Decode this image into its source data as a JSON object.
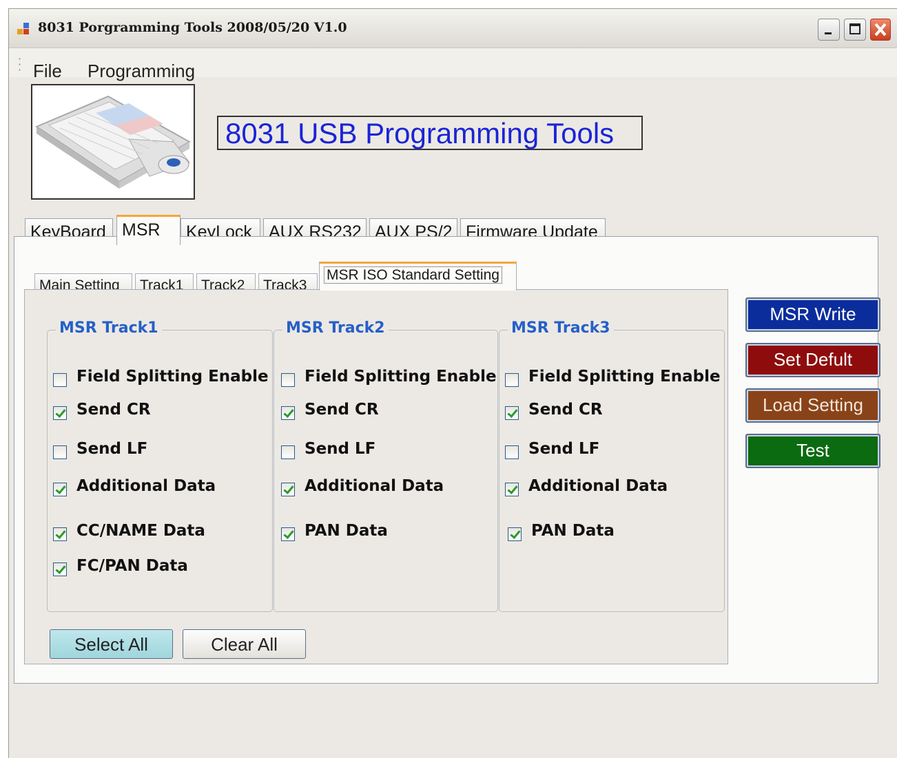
{
  "window": {
    "title": "8031 Porgramming Tools 2008/05/20 V1.0"
  },
  "menu": {
    "items": [
      "File",
      "Programming"
    ]
  },
  "header": {
    "app_heading": "8031 USB Programming Tools"
  },
  "main_tabs": [
    {
      "label": "KeyBoard",
      "active": false
    },
    {
      "label": "MSR",
      "active": true
    },
    {
      "label": "KeyLock",
      "active": false
    },
    {
      "label": "AUX RS232",
      "active": false
    },
    {
      "label": "AUX PS/2",
      "active": false
    },
    {
      "label": "Firmware Update",
      "active": false
    }
  ],
  "sub_tabs": [
    {
      "label": "Main Setting",
      "active": false
    },
    {
      "label": "Track1",
      "active": false
    },
    {
      "label": "Track2",
      "active": false
    },
    {
      "label": "Track3",
      "active": false
    },
    {
      "label": "MSR ISO Standard Setting",
      "active": true
    }
  ],
  "tracks": [
    {
      "title": "MSR Track1",
      "options": [
        {
          "label": "Field Splitting Enable",
          "checked": false
        },
        {
          "label": "Send CR",
          "checked": true
        },
        {
          "label": "Send LF",
          "checked": false
        },
        {
          "label": "Additional Data",
          "checked": true
        },
        {
          "label": "CC/NAME Data",
          "checked": true
        },
        {
          "label": "FC/PAN Data",
          "checked": true
        }
      ]
    },
    {
      "title": "MSR Track2",
      "options": [
        {
          "label": "Field Splitting Enable",
          "checked": false
        },
        {
          "label": "Send CR",
          "checked": true
        },
        {
          "label": "Send LF",
          "checked": false
        },
        {
          "label": "Additional Data",
          "checked": true
        },
        {
          "label": "PAN Data",
          "checked": true
        }
      ]
    },
    {
      "title": "MSR Track3",
      "options": [
        {
          "label": "Field Splitting Enable",
          "checked": false
        },
        {
          "label": "Send CR",
          "checked": true
        },
        {
          "label": "Send LF",
          "checked": false
        },
        {
          "label": "Additional Data",
          "checked": true
        },
        {
          "label": "PAN Data",
          "checked": true
        }
      ]
    }
  ],
  "actions": {
    "msr_write": {
      "label": "MSR Write",
      "color": "#0b2d9c"
    },
    "set_default": {
      "label": "Set Defult",
      "color": "#8e0c0c"
    },
    "load_setting": {
      "label": "Load Setting",
      "color": "#8a4318"
    },
    "test": {
      "label": "Test",
      "color": "#0a6b10"
    }
  },
  "bottom_buttons": {
    "select_all": "Select All",
    "clear_all": "Clear All"
  }
}
